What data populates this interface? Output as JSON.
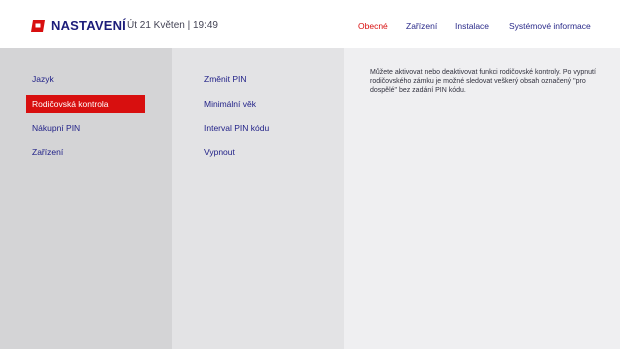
{
  "header": {
    "title": "NASTAVENÍ",
    "datetime": "Út 21 Květen | 19:49",
    "brand_color": "#d80f0f",
    "tabs": [
      {
        "label": "Obecné",
        "active": true
      },
      {
        "label": "Zařízení",
        "active": false
      },
      {
        "label": "Instalace",
        "active": false
      },
      {
        "label": "Systémové informace",
        "active": false
      }
    ]
  },
  "menu": {
    "items": [
      {
        "label": "Jazyk",
        "selected": false
      },
      {
        "label": "Rodičovská kontrola",
        "selected": true
      },
      {
        "label": "Nákupní PIN",
        "selected": false
      },
      {
        "label": "Zařízení",
        "selected": false
      }
    ]
  },
  "submenu": {
    "items": [
      {
        "label": "Změnit PIN"
      },
      {
        "label": "Minimální věk"
      },
      {
        "label": "Interval PIN kódu"
      },
      {
        "label": "Vypnout"
      }
    ]
  },
  "description": "Můžete aktivovat nebo deaktivovat funkci rodičovské kontroly. Po vypnutí rodičovského zámku je možné sledovat veškerý obsah označený \"pro dospělé\" bez zadání PIN kódu."
}
